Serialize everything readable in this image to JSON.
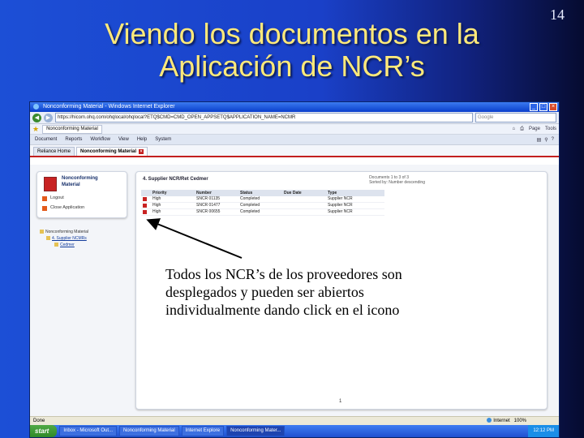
{
  "slide": {
    "title_line1": "Viendo los documentos en la",
    "title_line2": "Aplicación de NCR’s",
    "page_number": "14",
    "annotation_line1": "Todos los NCR’s de los proveedores son",
    "annotation_line2": "desplegados y pueden ser abiertos",
    "annotation_line3": "individualmente dando click en el icono",
    "title_color": "#ffe97a"
  },
  "browser": {
    "window_title": "Nonconforming Material - Windows Internet Explorer",
    "url": "https://hicom.ohq.com/ohqlocal/ohqlocal?ETQ$CMD=CMD_OPEN_APPSETQ$APPLICATION_NAME=NCMR",
    "search_placeholder": "Google",
    "fav_tab": "Nonconforming Material",
    "fav_tools": [
      "Page",
      "Tools"
    ],
    "menu": [
      "Document",
      "Reports",
      "Workflow",
      "View",
      "Help",
      "System"
    ]
  },
  "app": {
    "tabs": [
      {
        "label": "Reliance Home"
      },
      {
        "label": "Nonconforming Material"
      }
    ],
    "name_line1": "Nonconforming",
    "name_line2": "Material",
    "links": {
      "logout": "Logout",
      "close_app": "Close Application"
    },
    "tree": {
      "root": "Nonconforming Material",
      "child": "4. Supplier NCMRs",
      "leaf": "Cedmer"
    },
    "panel_title": "4. Supplier NCR/Ret Cedmer",
    "doc_info_line1": "Documents 1 to 3 of 3",
    "doc_info_line2": "Sorted by: Number descending",
    "columns": [
      "Priority",
      "Number",
      "Status",
      "Due Date",
      "Type"
    ],
    "rows": [
      {
        "priority": "High",
        "number": "SNCR 01135",
        "status": "Completed",
        "due": "",
        "type": "Supplier NCR"
      },
      {
        "priority": "High",
        "number": "SNCR 01477",
        "status": "Completed",
        "due": "",
        "type": "Supplier NCR"
      },
      {
        "priority": "High",
        "number": "SNCR 00655",
        "status": "Completed",
        "due": "",
        "type": "Supplier NCR"
      }
    ],
    "pager": "1"
  },
  "status": {
    "left": "Done",
    "right": "Internet",
    "zoom": "100%"
  },
  "taskbar": {
    "start": "start",
    "tasks": [
      "Inbox - Microsoft Out...",
      "Nonconforming Material",
      "Internet Explore",
      "Nonconforming Mater..."
    ],
    "clock": "12:12 PM"
  }
}
